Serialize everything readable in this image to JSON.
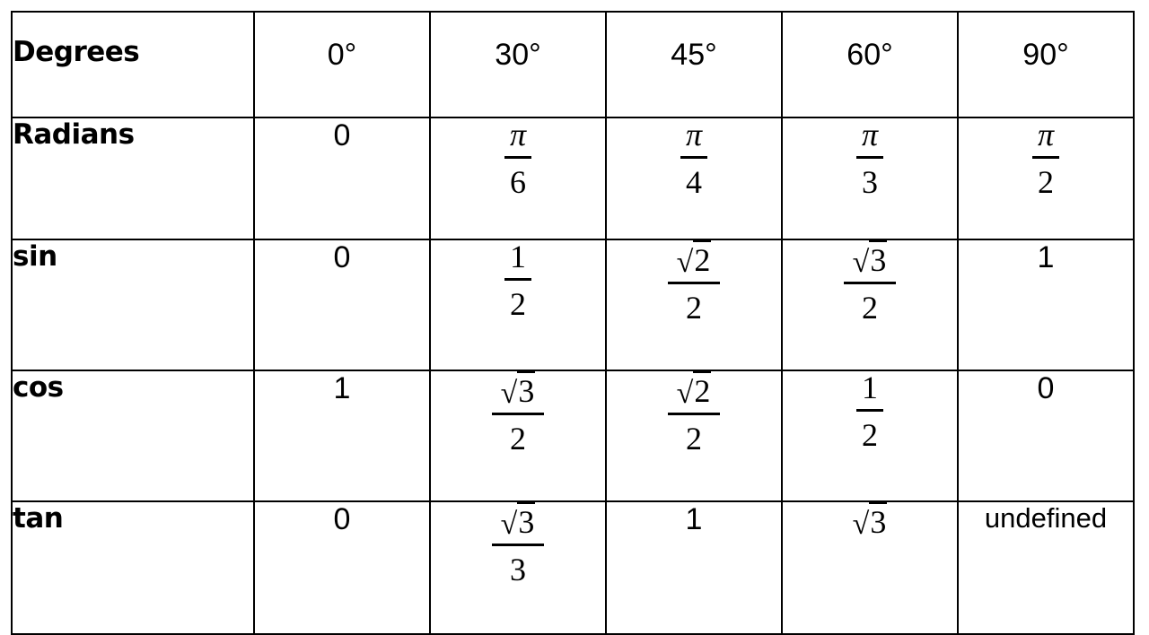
{
  "table": {
    "columns": [
      "0°",
      "30°",
      "45°",
      "60°",
      "90°"
    ],
    "rows": [
      {
        "label": "Degrees",
        "cells": [
          {
            "type": "plain",
            "text": "0°"
          },
          {
            "type": "plain",
            "text": "30°"
          },
          {
            "type": "plain",
            "text": "45°"
          },
          {
            "type": "plain",
            "text": "60°"
          },
          {
            "type": "plain",
            "text": "90°"
          }
        ]
      },
      {
        "label": "Radians",
        "cells": [
          {
            "type": "plain",
            "text": "0"
          },
          {
            "type": "frac",
            "num": "π",
            "den": "6",
            "num_italic": true
          },
          {
            "type": "frac",
            "num": "π",
            "den": "4",
            "num_italic": true
          },
          {
            "type": "frac",
            "num": "π",
            "den": "3",
            "num_italic": true
          },
          {
            "type": "frac",
            "num": "π",
            "den": "2",
            "num_italic": true
          }
        ]
      },
      {
        "label": "sin",
        "cells": [
          {
            "type": "plain",
            "text": "0"
          },
          {
            "type": "frac",
            "num": "1",
            "den": "2"
          },
          {
            "type": "frac",
            "num_sqrt": "2",
            "den": "2"
          },
          {
            "type": "frac",
            "num_sqrt": "3",
            "den": "2"
          },
          {
            "type": "plain",
            "text": "1"
          }
        ]
      },
      {
        "label": "cos",
        "cells": [
          {
            "type": "plain",
            "text": "1"
          },
          {
            "type": "frac",
            "num_sqrt": "3",
            "den": "2"
          },
          {
            "type": "frac",
            "num_sqrt": "2",
            "den": "2"
          },
          {
            "type": "frac",
            "num": "1",
            "den": "2"
          },
          {
            "type": "plain",
            "text": "0"
          }
        ]
      },
      {
        "label": "tan",
        "cells": [
          {
            "type": "plain",
            "text": "0"
          },
          {
            "type": "frac",
            "num_sqrt": "3",
            "den": "3"
          },
          {
            "type": "plain",
            "text": "1"
          },
          {
            "type": "sqrt",
            "text": "3"
          },
          {
            "type": "word",
            "text": "undefined"
          }
        ]
      }
    ],
    "radical_symbol": "√"
  }
}
